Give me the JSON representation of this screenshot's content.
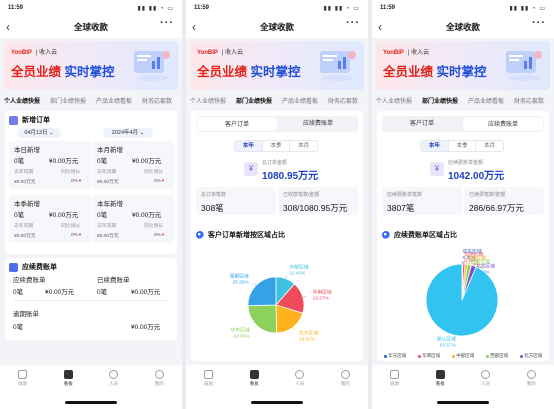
{
  "status_time": "11:59",
  "status_icons": "▮▮ ▮▮ ◔ ▭",
  "nav": {
    "title": "全球收款",
    "back": "‹",
    "more": "···"
  },
  "banner": {
    "brand": "YonBIP",
    "brand2": "| 收入云",
    "headline_a": "全员业绩",
    "headline_b": "实时掌控"
  },
  "tabs": [
    "个人业绩快报",
    "部门业绩快报",
    "产品业绩看板",
    "财务応套数"
  ],
  "bottom_nav": [
    "收款",
    "看板",
    "人员",
    "我的"
  ],
  "p1": {
    "section1": {
      "title": "新增订单",
      "date1": "04月13日 ⌄",
      "date2": "2024年4月 ⌄"
    },
    "tiles": [
      {
        "label": "本日新增",
        "count": "0笔",
        "amount": "¥0.00万元",
        "l1": "去年同期",
        "l2": "同比增长",
        "v1": "¥0.00万元",
        "v2": "0%"
      },
      {
        "label": "本月新增",
        "count": "0笔",
        "amount": "¥0.00万元",
        "l1": "去年同期",
        "l2": "同比增长",
        "v1": "¥0.00万元",
        "v2": "0%"
      },
      {
        "label": "本季新增",
        "count": "0笔",
        "amount": "¥0.00万元",
        "l1": "去年同期",
        "l2": "同比增长",
        "v1": "¥0.00万元",
        "v2": "0%"
      },
      {
        "label": "本年新增",
        "count": "0笔",
        "amount": "¥0.00万元",
        "l1": "去年同期",
        "l2": "同比增长",
        "v1": "¥0.00万元",
        "v2": "0%"
      }
    ],
    "section2": {
      "title": "应续费账单"
    },
    "bills": [
      {
        "label": "应续费账单",
        "count": "0笔",
        "amount": "¥0.00万元"
      },
      {
        "label": "已续费账单",
        "count": "0笔",
        "amount": "¥0.00万元"
      },
      {
        "label": "逾期账单",
        "count": "0笔",
        "amount": "¥0.00万元"
      }
    ]
  },
  "p2": {
    "top_seg": [
      "客户订单",
      "应续费账单"
    ],
    "seg": [
      "本年",
      "本季",
      "本月"
    ],
    "total_label": "总订单金额",
    "total_value": "1080.95万元",
    "stat1": {
      "label": "总订单笔数",
      "value": "308笔"
    },
    "stat2": {
      "label": "已收款笔数/金额",
      "value": "308/1080.95万元"
    },
    "chart_title": "客户订单新增按区域占比"
  },
  "p3": {
    "top_seg": [
      "客户订单",
      "应续费账单"
    ],
    "seg": [
      "本年",
      "本季",
      "本月"
    ],
    "total_label": "应续费账单金额",
    "total_value": "1042.00万元",
    "stat1": {
      "label": "应续费账单笔数",
      "value": "3807笔"
    },
    "stat2": {
      "label": "已续费笔数/金额",
      "value": "286/66.97万元"
    },
    "chart_title": "应续费账单区域占比"
  },
  "chart_data": [
    {
      "type": "pie",
      "title": "客户订单新增按区域占比",
      "categories": [
        "中部区域",
        "华南区域",
        "北方区域",
        "华东区域",
        "西部区域"
      ],
      "values": [
        11.46,
        18.27,
        19.92,
        24.96,
        25.39
      ],
      "labels": [
        "11.46%",
        "18.27%",
        "19.92%",
        "24.96%",
        "25.39%"
      ],
      "colors": [
        "#3ec1e0",
        "#f04b5a",
        "#ffb21e",
        "#8cd15a",
        "#34a3e6"
      ]
    },
    {
      "type": "pie",
      "title": "应续费账单区域占比",
      "categories": [
        "华东区域",
        "华南区域",
        "中部区域",
        "西部区域",
        "北方区域",
        "弹认区域"
      ],
      "values": [
        0.34,
        0.99,
        1.14,
        1.75,
        2.22,
        93.57
      ],
      "labels": [
        "0.34%",
        "0.99%",
        "1.14%",
        "1.75%",
        "2.22%",
        "93.57%"
      ],
      "colors": [
        "#1f5fd0",
        "#f04b5a",
        "#ffb21e",
        "#8cd15a",
        "#7a4fd6",
        "#33c3f0"
      ],
      "legend": [
        "华东区域",
        "华南区域",
        "中部区域",
        "西部区域",
        "北方区域"
      ]
    }
  ]
}
